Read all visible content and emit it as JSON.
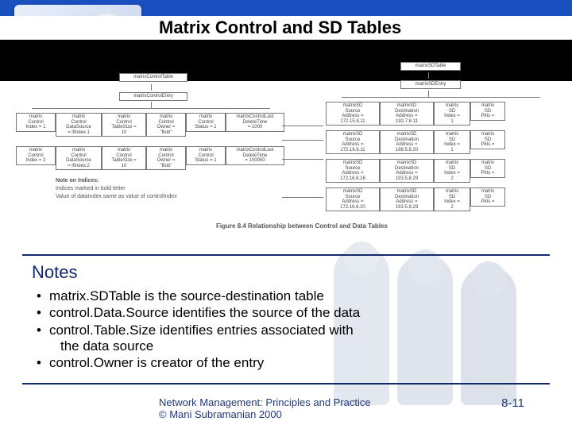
{
  "header": {
    "title": "Matrix Control and SD Tables"
  },
  "diagram": {
    "top_left_label": "matrixControlTable",
    "mid_left_label": "matrixControlEntry",
    "top_right_label": "matrixSDTable",
    "mid_right_label": "matrixSDEntry",
    "control_row1": {
      "c0": "matrix\nControl\nIndex = 1",
      "c1": "matrix\nControl\nDataSource\n= ifIndex.1",
      "c2": "matrix\nControl\nTableSize =\n10",
      "c3": "matrix\nControl\nOwner =\n\"Bob\"",
      "c4": "matrix\nControl\nStatus = 1",
      "c5": "matrixControlLast\nDeleteTime\n= 1000"
    },
    "control_row2": {
      "c0": "matrix\nControl\nIndex = 2",
      "c1": "matrix\nControl\nDataSource\n= ifIndex.2",
      "c2": "matrix\nControl\nTableSize =\n10",
      "c3": "matrix\nControl\nOwner =\n\"Bob\"",
      "c4": "matrix\nControl\nStatus = 1",
      "c5": "matrixControlLast\nDeleteTime\n= 100050"
    },
    "sd_row1": {
      "s0": "matrixSD\nSource\nAddress =\n172.15.8.11",
      "s1": "matrixSD\nDestination\nAddress =\n192.7.8.11",
      "s2": "matrix\nSD\nIndex =\n1",
      "s3": "matrix\nSD\nPkts ="
    },
    "sd_row2": {
      "s0": "matrixSD\nSource\nAddress =\n172.16.8.11",
      "s1": "matrixSD\nDestination\nAddress =\n198.5.8.20",
      "s2": "matrix\nSD\nIndex =\n1",
      "s3": "matrix\nSD\nPkts ="
    },
    "sd_row3": {
      "s0": "matrixSD\nSource\nAddress =\n172.16.8.16",
      "s1": "matrixSD\nDestination\nAddress =\n193.5.8.29",
      "s2": "matrix\nSD\nIndex =\n2",
      "s3": "matrix\nSD\nPkts ="
    },
    "sd_row4": {
      "s0": "matrixSD\nSource\nAddress =\n172.16.8.20",
      "s1": "matrixSD\nDestination\nAddress =\n193.5.8.29",
      "s2": "matrix\nSD\nIndex =\n2",
      "s3": "matrix\nSD\nPkts ="
    },
    "note_line1": "Note on Indices:",
    "note_line2": "Indices marked in bold letter",
    "note_line3": "Value of dataIndex same as value of controlIndex",
    "caption": "Figure 8.4 Relationship between Control and Data Tables"
  },
  "notes": {
    "heading": "Notes",
    "b0": "matrix.SDTable is the source-destination table",
    "b1": "control.Data.Source identifies the source of the data",
    "b2": "control.Table.Size identifies entries associated with",
    "b2b": "the data source",
    "b3": "control.Owner is creator of the entry"
  },
  "footer": {
    "line1": "Network Management: Principles and Practice",
    "line2": "©  Mani Subramanian 2000",
    "page": "8-11"
  }
}
